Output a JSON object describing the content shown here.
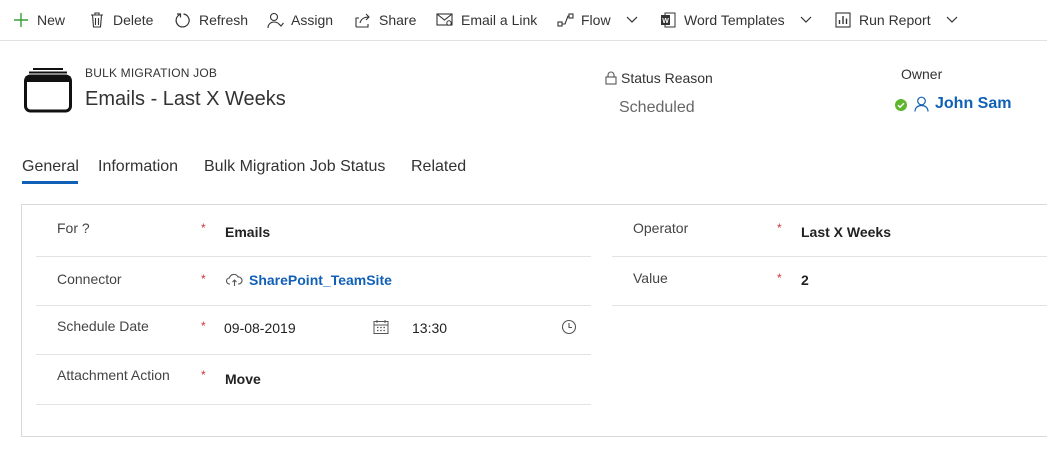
{
  "toolbar": {
    "new": "New",
    "delete": "Delete",
    "refresh": "Refresh",
    "assign": "Assign",
    "share": "Share",
    "email_link": "Email a Link",
    "flow": "Flow",
    "word_templates": "Word Templates",
    "run_report": "Run Report"
  },
  "header": {
    "entity_type": "BULK MIGRATION JOB",
    "title": "Emails - Last X Weeks",
    "status_reason_label": "Status Reason",
    "status_reason_value": "Scheduled",
    "owner_label": "Owner",
    "owner_value": "John Sam",
    "accent_color": "#1160b7",
    "presence_color": "#5db62b"
  },
  "tabs": [
    {
      "label": "General",
      "active": true
    },
    {
      "label": "Information",
      "active": false
    },
    {
      "label": "Bulk Migration Job Status",
      "active": false
    },
    {
      "label": "Related",
      "active": false
    }
  ],
  "form": {
    "required_marker": "*",
    "left": {
      "for_label": "For ?",
      "for_value": "Emails",
      "connector_label": "Connector",
      "connector_value": "SharePoint_TeamSite",
      "schedule_date_label": "Schedule Date",
      "schedule_date_value": "09-08-2019",
      "schedule_time_value": "13:30",
      "attachment_action_label": "Attachment Action",
      "attachment_action_value": "Move"
    },
    "right": {
      "operator_label": "Operator",
      "operator_value": "Last X Weeks",
      "value_label": "Value",
      "value_value": "2"
    }
  },
  "icons": {
    "new": "plus-icon",
    "delete": "trash-icon",
    "refresh": "refresh-icon",
    "assign": "person-icon",
    "share": "share-icon",
    "email_link": "email-link-icon",
    "flow": "flow-icon",
    "word_templates": "word-icon",
    "run_report": "report-icon",
    "calendar": "calendar-icon",
    "clock": "clock-icon",
    "lock": "lock-icon",
    "cloud": "cloud-icon"
  }
}
